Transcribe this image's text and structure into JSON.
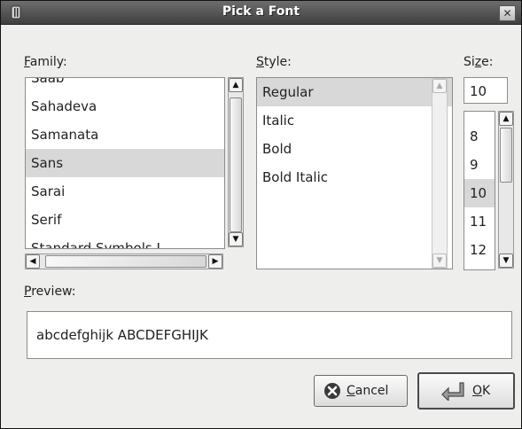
{
  "window": {
    "title": "Pick a Font"
  },
  "family": {
    "label_mnemonic": "F",
    "label_rest": "amily:",
    "items": [
      "Saab",
      "Sahadeva",
      "Samanata",
      "Sans",
      "Sarai",
      "Serif",
      "Standard Symbols L"
    ],
    "selected": "Sans"
  },
  "style": {
    "label_mnemonic": "S",
    "label_rest": "tyle:",
    "items": [
      "Regular",
      "Italic",
      "Bold",
      "Bold Italic"
    ],
    "selected": "Regular"
  },
  "size": {
    "label_pre": "Si",
    "label_mnemonic": "z",
    "label_rest": "e:",
    "value": "10",
    "items": [
      "8",
      "9",
      "10",
      "11",
      "12"
    ],
    "selected": "10"
  },
  "preview": {
    "label_mnemonic": "P",
    "label_rest": "review:",
    "text": "abcdefghijk ABCDEFGHIJK"
  },
  "buttons": {
    "cancel_mnemonic": "C",
    "cancel_rest": "ancel",
    "ok_mnemonic": "O",
    "ok_rest": "K"
  }
}
